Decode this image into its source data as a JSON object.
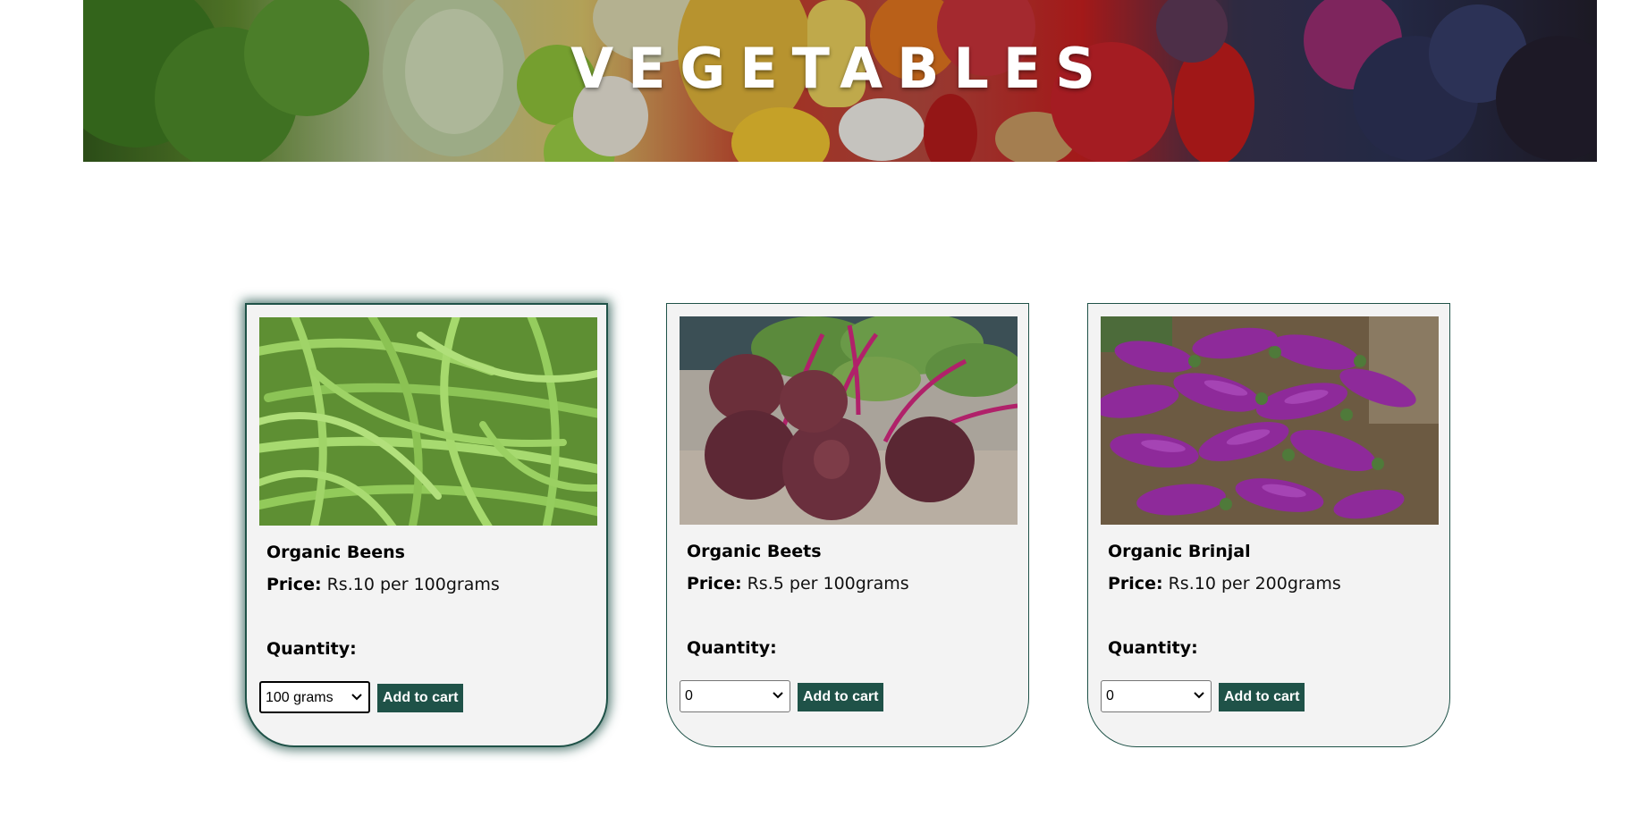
{
  "banner": {
    "title": "VEGETABLES"
  },
  "theme": {
    "accent": "#1f5248",
    "card_background": "#f3f3f3"
  },
  "products": [
    {
      "name": "Organic Beens",
      "price_label": "Price:",
      "price_text": "Rs.10 per 100grams",
      "quantity_label": "Quantity:",
      "quantity_selected": "100 grams",
      "add_button": "Add to cart",
      "image": "green-beans"
    },
    {
      "name": "Organic Beets",
      "price_label": "Price:",
      "price_text": "Rs.5 per 100grams",
      "quantity_label": "Quantity:",
      "quantity_selected": "0",
      "add_button": "Add to cart",
      "image": "beetroots"
    },
    {
      "name": "Organic Brinjal",
      "price_label": "Price:",
      "price_text": "Rs.10 per 200grams",
      "quantity_label": "Quantity:",
      "quantity_selected": "0",
      "add_button": "Add to cart",
      "image": "brinjals"
    }
  ]
}
